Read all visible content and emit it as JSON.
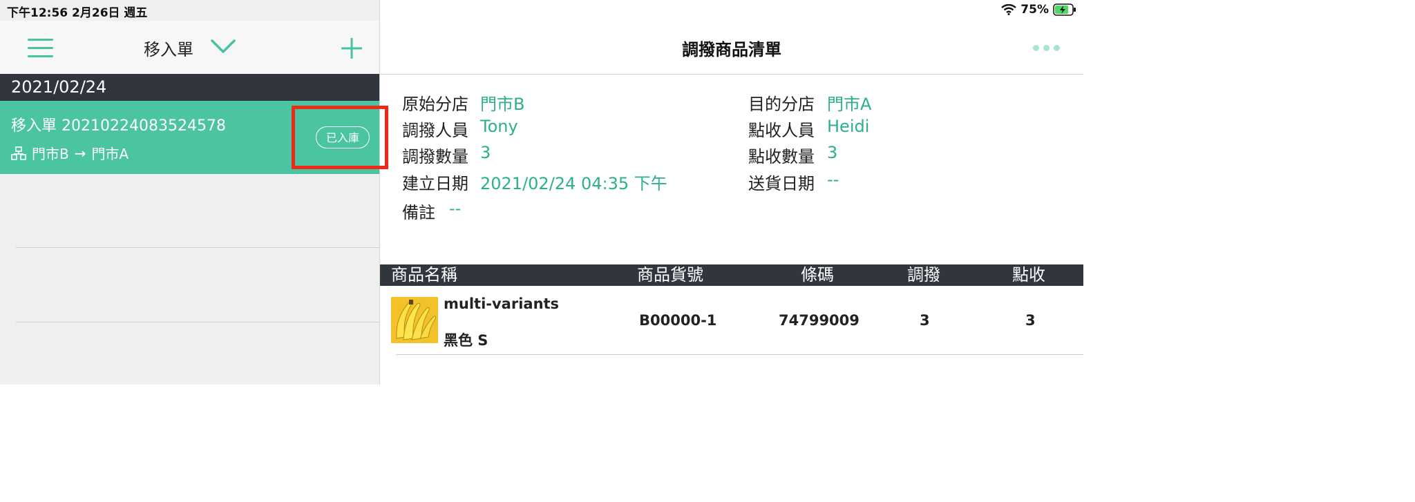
{
  "status_bar": {
    "time_date": "下午12:56   2月26日 週五",
    "battery": "75%"
  },
  "list_header": {
    "title": "移入單"
  },
  "list": {
    "date_header": "2021/02/24",
    "item": {
      "title": "移入單  20210224083524578",
      "from": "門市B",
      "to": "門市A",
      "arrow": "→",
      "status": "已入庫"
    }
  },
  "detail_header": {
    "title": "調撥商品清單"
  },
  "detail": {
    "source_store_label": "原始分店",
    "source_store": "門市B",
    "dest_store_label": "目的分店",
    "dest_store": "門市A",
    "transfer_staff_label": "調撥人員",
    "transfer_staff": "Tony",
    "receive_staff_label": "點收人員",
    "receive_staff": "Heidi",
    "transfer_qty_label": "調撥數量",
    "transfer_qty": "3",
    "receive_qty_label": "點收數量",
    "receive_qty": "3",
    "created_label": "建立日期",
    "created": "2021/02/24 04:35 下午",
    "ship_date_label": "送貨日期",
    "ship_date": "--",
    "note_label": "備註",
    "note": "--"
  },
  "table": {
    "headers": [
      "商品名稱",
      "商品貨號",
      "條碼",
      "調撥",
      "點收"
    ],
    "rows": [
      {
        "name": "multi-variants",
        "variant": "黑色 S",
        "sku": "B00000-1",
        "barcode": "74799009",
        "transfer": "3",
        "received": "3",
        "image": "banana-photo"
      }
    ]
  },
  "colors": {
    "accent": "#4bc4a2",
    "dark_bar": "#31363e",
    "highlight": "#ee2a17",
    "value_text": "#2bb08b"
  }
}
